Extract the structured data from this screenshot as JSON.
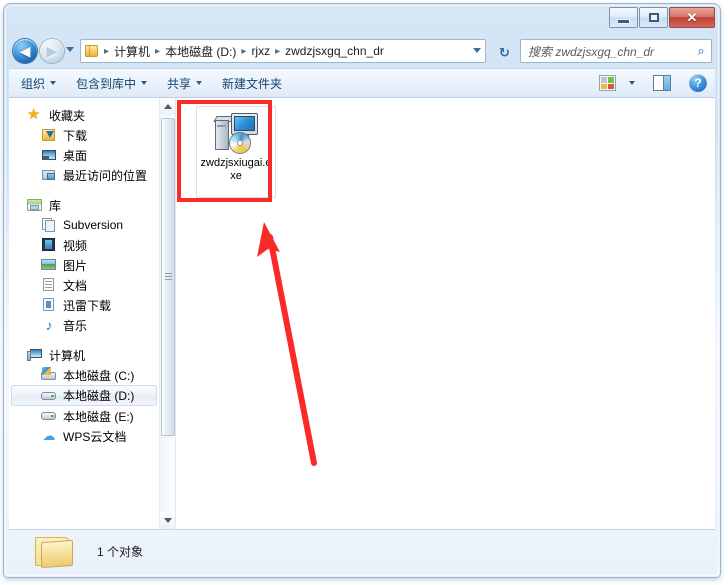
{
  "window": {
    "caption_buttons": {
      "minimize_label": "–",
      "maximize_label": "",
      "close_label": "✕"
    }
  },
  "address_bar": {
    "back_glyph": "◀",
    "forward_glyph": "▶",
    "breadcrumb": [
      "计算机",
      "本地磁盘 (D:)",
      "rjxz",
      "zwdzjsxgq_chn_dr"
    ],
    "separator": "▸",
    "refresh_glyph": "↻"
  },
  "search": {
    "placeholder": "搜索 zwdzjsxgq_chn_dr",
    "icon_glyph": "⌕"
  },
  "toolbar": {
    "items": [
      {
        "label": "组织",
        "has_caret": true
      },
      {
        "label": "包含到库中",
        "has_caret": true
      },
      {
        "label": "共享",
        "has_caret": true
      },
      {
        "label": "新建文件夹",
        "has_caret": false
      }
    ],
    "help_glyph": "?"
  },
  "sidebar": {
    "groups": [
      {
        "header": {
          "label": "收藏夹",
          "icon": "star-icon"
        },
        "items": [
          {
            "label": "下载",
            "icon": "download-icon"
          },
          {
            "label": "桌面",
            "icon": "desktop-icon"
          },
          {
            "label": "最近访问的位置",
            "icon": "recent-places-icon"
          }
        ]
      },
      {
        "header": {
          "label": "库",
          "icon": "library-icon"
        },
        "items": [
          {
            "label": "Subversion",
            "icon": "subversion-icon"
          },
          {
            "label": "视频",
            "icon": "video-icon"
          },
          {
            "label": "图片",
            "icon": "picture-icon"
          },
          {
            "label": "文档",
            "icon": "document-icon"
          },
          {
            "label": "迅雷下载",
            "icon": "thunder-download-icon"
          },
          {
            "label": "音乐",
            "icon": "music-icon"
          }
        ]
      },
      {
        "header": {
          "label": "计算机",
          "icon": "computer-icon"
        },
        "items": [
          {
            "label": "本地磁盘 (C:)",
            "icon": "system-drive-icon",
            "selected": false
          },
          {
            "label": "本地磁盘 (D:)",
            "icon": "drive-icon",
            "selected": true
          },
          {
            "label": "本地磁盘 (E:)",
            "icon": "drive-icon",
            "selected": false
          },
          {
            "label": "WPS云文档",
            "icon": "cloud-icon",
            "selected": false
          }
        ]
      }
    ]
  },
  "file_pane": {
    "items": [
      {
        "name": "zwdzjsxiugai.exe",
        "icon": "computer-setup-exe-icon"
      }
    ]
  },
  "annotations": {
    "highlight_color": "#fa2a28",
    "rectangle_target": "zwdzjsxiugai.exe",
    "arrow_points_to": "zwdzjsxiugai.exe"
  },
  "status_bar": {
    "text": "1 个对象",
    "icon": "folder-icon"
  }
}
